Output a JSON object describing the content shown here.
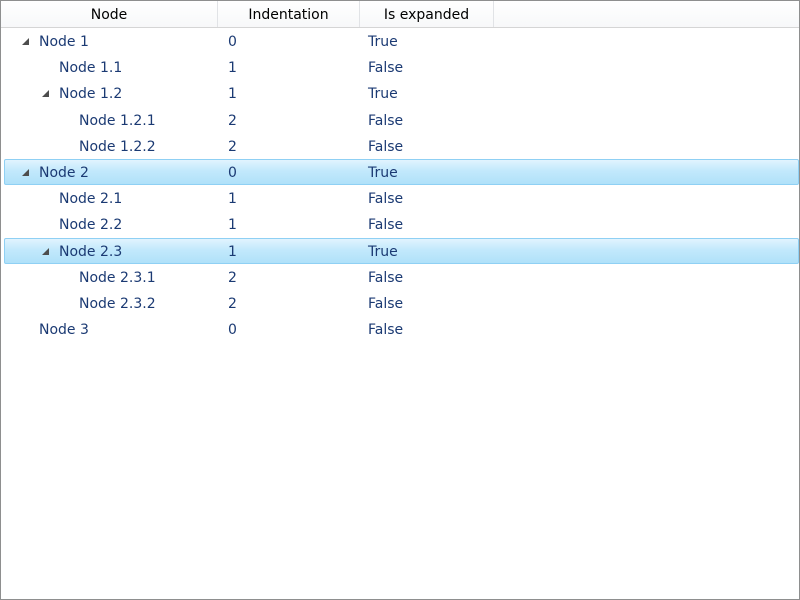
{
  "columns": {
    "node": "Node",
    "indentation": "Indentation",
    "is_expanded": "Is expanded"
  },
  "rows": [
    {
      "label": "Node 1",
      "indentation": "0",
      "expanded": "True",
      "level": 0,
      "has_children": true,
      "selected": false
    },
    {
      "label": "Node 1.1",
      "indentation": "1",
      "expanded": "False",
      "level": 1,
      "has_children": false,
      "selected": false
    },
    {
      "label": "Node 1.2",
      "indentation": "1",
      "expanded": "True",
      "level": 1,
      "has_children": true,
      "selected": false
    },
    {
      "label": "Node 1.2.1",
      "indentation": "2",
      "expanded": "False",
      "level": 2,
      "has_children": false,
      "selected": false
    },
    {
      "label": "Node 1.2.2",
      "indentation": "2",
      "expanded": "False",
      "level": 2,
      "has_children": false,
      "selected": false
    },
    {
      "label": "Node 2",
      "indentation": "0",
      "expanded": "True",
      "level": 0,
      "has_children": true,
      "selected": true
    },
    {
      "label": "Node 2.1",
      "indentation": "1",
      "expanded": "False",
      "level": 1,
      "has_children": false,
      "selected": false
    },
    {
      "label": "Node 2.2",
      "indentation": "1",
      "expanded": "False",
      "level": 1,
      "has_children": false,
      "selected": false
    },
    {
      "label": "Node 2.3",
      "indentation": "1",
      "expanded": "True",
      "level": 1,
      "has_children": true,
      "selected": true
    },
    {
      "label": "Node 2.3.1",
      "indentation": "2",
      "expanded": "False",
      "level": 2,
      "has_children": false,
      "selected": false
    },
    {
      "label": "Node 2.3.2",
      "indentation": "2",
      "expanded": "False",
      "level": 2,
      "has_children": false,
      "selected": false
    },
    {
      "label": "Node 3",
      "indentation": "0",
      "expanded": "False",
      "level": 0,
      "has_children": false,
      "selected": false
    }
  ],
  "colors": {
    "text": "#1b3a73",
    "selection": "#c2e9fc",
    "selection_border": "#8fd0f4",
    "window_border": "#8e8f8f"
  },
  "icons": {
    "expander": "expanded-triangle-icon"
  }
}
